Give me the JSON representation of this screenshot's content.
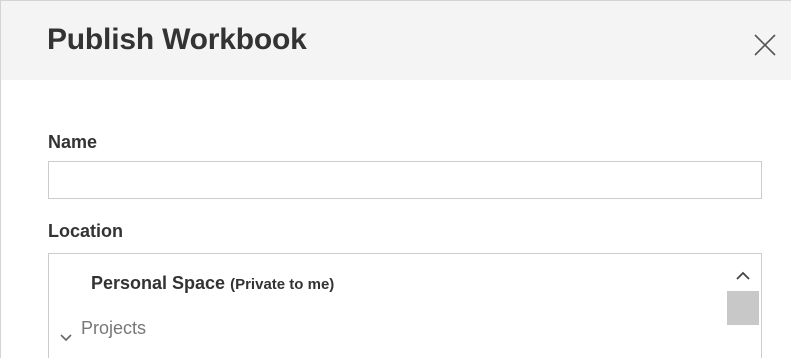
{
  "dialog": {
    "title": "Publish Workbook",
    "close_icon": "close-icon"
  },
  "name_field": {
    "label": "Name",
    "value": "",
    "placeholder": ""
  },
  "location": {
    "label": "Location",
    "items": [
      {
        "label": "Personal Space",
        "sublabel": "(Private to me)"
      },
      {
        "label": "Projects",
        "icon": "chevron-down-icon",
        "expanded": true
      }
    ],
    "scroll_up_icon": "chevron-up-icon"
  }
}
